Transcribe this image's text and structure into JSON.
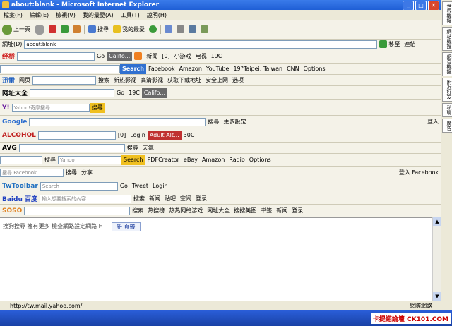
{
  "window": {
    "title": "about:blank - Microsoft Internet Explorer"
  },
  "menu": [
    "檔案(F)",
    "編輯(E)",
    "檢視(V)",
    "我的最愛(A)",
    "工具(T)",
    "說明(H)"
  ],
  "nav": {
    "back": "上一頁",
    "search": "搜尋",
    "favorites": "我的最愛"
  },
  "address": {
    "label": "網址(D)",
    "value": "about:blank",
    "go": "移至",
    "links": "連結"
  },
  "bars": {
    "jingling": {
      "logo": "经桥",
      "go": "Go",
      "city": "Califo...",
      "news": "新聞",
      "count": "[0]",
      "game": "小游戏",
      "tv": "电视",
      "temp": "19C"
    },
    "google1": {
      "search": "Search",
      "facebook": "Facebook",
      "amazon": "Amazon",
      "youtube": "YouTube",
      "weather": "19?Taipei, Taiwan",
      "cnn": "CNN",
      "options": "Options"
    },
    "xunlei": {
      "logo": "迅雷",
      "web": "网页",
      "search": "搜索",
      "movie": "新热影视",
      "hot": "高清影视",
      "download": "获取下载地址",
      "safe": "安全上网",
      "options": "选项"
    },
    "wangzhi": {
      "logo": "网址大全",
      "go": "Go",
      "temp": "19C",
      "city": "Califo..."
    },
    "yahoo": {
      "placeholder": "Yahoo!奇摩搜尋",
      "search": "搜尋"
    },
    "google2": {
      "logo": "Google",
      "search": "搜尋",
      "more": "更多設定",
      "login": "登入"
    },
    "alcohol": {
      "logo": "ALCOHOL",
      "count": "[0]",
      "login": "Login",
      "adult": "Adult Alt...",
      "temp": "30C"
    },
    "avg": {
      "logo": "AVG",
      "search": "搜尋",
      "weather": "天氣"
    },
    "search5": {
      "go": "搜尋",
      "placeholder": "Yahoo",
      "search": "Search",
      "pdf": "PDFCreator",
      "ebay": "eBay",
      "amazon": "Amazon",
      "radio": "Radio",
      "options": "Options"
    },
    "facebook": {
      "placeholder": "搜尋 Facebook",
      "search": "搜尋",
      "share": "分享",
      "login": "登入 Facebook"
    },
    "twtoolbar": {
      "logo": "TwToolbar",
      "placeholder": "Search",
      "go": "Go",
      "tweet": "Tweet",
      "login": "Login"
    },
    "baidu": {
      "logo": "Baidu 百度",
      "placeholder": "輸入想要搜索的內容",
      "search": "搜索",
      "news": "新闻",
      "post": "贴吧",
      "space": "空间",
      "login": "登录"
    },
    "soso": {
      "logo": "SOSO",
      "search": "搜索",
      "hot": "热搜榜",
      "game": "热热网络游戏",
      "nav": "网址大全",
      "hotsearch": "搜搜美图",
      "bookmark": "书签",
      "news": "新闻",
      "login": "登录"
    }
  },
  "content": {
    "text": "搜狗搜尋 擁有更多 檢查網路設定網路 H",
    "button": "新 頁籤"
  },
  "status": {
    "url": "http://tw.mail.yahoo.com/",
    "zone": "網際網路"
  },
  "side": [
    "世界機搜",
    "網站機搜",
    "網頁機搜",
    "附近好友",
    "私聊",
    "廣告"
  ],
  "taskbar": {
    "brand": "卡提諾論壇 CK101.COM"
  }
}
